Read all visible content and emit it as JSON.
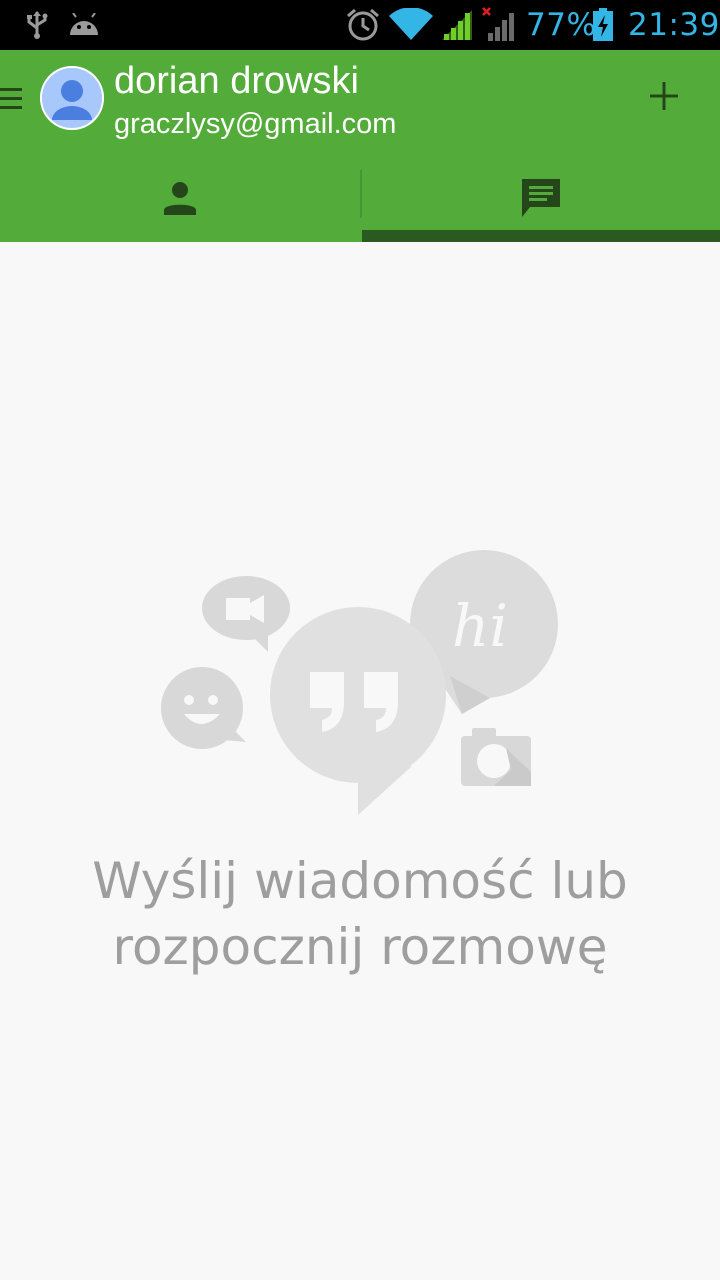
{
  "status_bar": {
    "icons": [
      "usb-icon",
      "android-debug-icon",
      "alarm-icon",
      "wifi-icon",
      "signal-icon",
      "signal-no-service-icon",
      "battery-charging-icon"
    ],
    "battery_percent": "77%",
    "time": "21:39",
    "text_color": "#33b5e5"
  },
  "header": {
    "background_color": "#53ac3a",
    "user_name": "dorian drowski",
    "user_email": "graczlysy@gmail.com",
    "add_icon": "plus-icon",
    "menu_icon": "hamburger-icon"
  },
  "tabs": [
    {
      "icon": "person-icon",
      "selected": false
    },
    {
      "icon": "chat-icon",
      "selected": true
    }
  ],
  "empty_state": {
    "line1": "Wyślij wiadomość lub",
    "line2": "rozpocznij rozmowę",
    "illustration_icons": [
      "video-bubble-icon",
      "smiley-bubble-icon",
      "quote-bubble-icon",
      "hi-bubble-icon",
      "camera-icon"
    ]
  }
}
